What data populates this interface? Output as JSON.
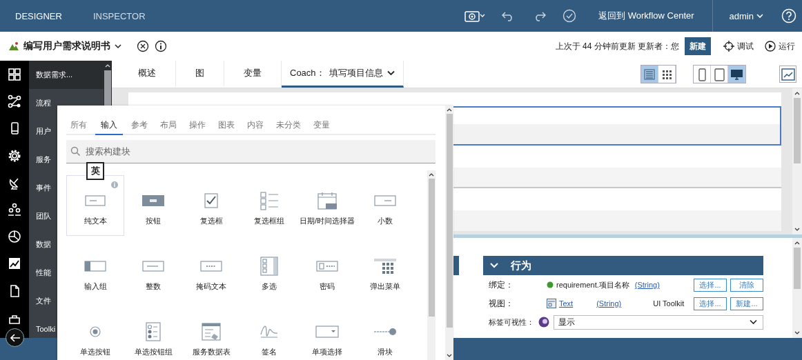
{
  "top_bar": {
    "tabs": [
      {
        "label": "DESIGNER",
        "selected": true
      },
      {
        "label": "INSPECTOR",
        "selected": false
      }
    ],
    "return_link": "返回到 Workflow Center",
    "user": "admin"
  },
  "title_bar": {
    "title": "编写用户需求说明书",
    "status": "上次于 44 分钟前更新 更新者：您",
    "new_button": "新建",
    "debug": "调试",
    "run": "运行"
  },
  "nav": {
    "items": [
      {
        "label": "数据需求...",
        "selected": true
      },
      {
        "label": "流程",
        "selected": false
      },
      {
        "label": "用户",
        "selected": false
      },
      {
        "label": "服务",
        "selected": false
      },
      {
        "label": "事件",
        "selected": false
      },
      {
        "label": "团队",
        "selected": false
      },
      {
        "label": "数据",
        "selected": false
      },
      {
        "label": "性能",
        "selected": false
      },
      {
        "label": "文件",
        "selected": false
      },
      {
        "label": "Toolki",
        "selected": false
      }
    ]
  },
  "editor_tabs": [
    {
      "kind": "plain",
      "label": "概述",
      "selected": false
    },
    {
      "kind": "plain",
      "label": "图",
      "selected": false
    },
    {
      "kind": "plain",
      "label": "变量",
      "selected": false
    },
    {
      "kind": "dropdown",
      "label": "Coach：",
      "value": "填写项目信息",
      "selected": true
    }
  ],
  "layout_toggles": [
    {
      "selected": true
    },
    {
      "selected": false
    }
  ],
  "device_toggles": [
    {
      "selected": false
    },
    {
      "selected": false
    },
    {
      "selected": true
    }
  ],
  "palette": {
    "tabs": [
      {
        "label": "所有",
        "selected": false
      },
      {
        "label": "输入",
        "selected": true
      },
      {
        "label": "参考",
        "selected": false
      },
      {
        "label": "布局",
        "selected": false
      },
      {
        "label": "操作",
        "selected": false
      },
      {
        "label": "图表",
        "selected": false
      },
      {
        "label": "内容",
        "selected": false
      },
      {
        "label": "未分类",
        "selected": false
      },
      {
        "label": "变量",
        "selected": false
      }
    ],
    "search": {
      "placeholder": "搜索构建块"
    },
    "ime_hint": "英",
    "items": [
      {
        "label": "纯文本",
        "selected": true
      },
      {
        "label": "按钮",
        "selected": false
      },
      {
        "label": "复选框",
        "selected": false
      },
      {
        "label": "复选框组",
        "selected": false
      },
      {
        "label": "日期/时间选择器",
        "selected": false
      },
      {
        "label": "小数",
        "selected": false
      },
      {
        "label": "输入组",
        "selected": false
      },
      {
        "label": "整数",
        "selected": false
      },
      {
        "label": "掩码文本",
        "selected": false
      },
      {
        "label": "多选",
        "selected": false
      },
      {
        "label": "密码",
        "selected": false
      },
      {
        "label": "弹出菜单",
        "selected": false
      },
      {
        "label": "单选按钮",
        "selected": false
      },
      {
        "label": "单选按钮组",
        "selected": false
      },
      {
        "label": "服务数据表",
        "selected": false
      },
      {
        "label": "签名",
        "selected": false
      },
      {
        "label": "单项选择",
        "selected": false
      },
      {
        "label": "滑块",
        "selected": false
      }
    ]
  },
  "properties": {
    "section": {
      "title": "行为",
      "expanded": true
    },
    "binding": {
      "label": "绑定：",
      "value": "requirement.项目名称",
      "type": "(String)",
      "buttons": [
        "选择...",
        "清除"
      ]
    },
    "view": {
      "label": "视图：",
      "value": "Text",
      "type": "(String)",
      "toolkit": "UI Toolkit",
      "buttons": [
        "选择...",
        "新建..."
      ]
    },
    "label_visibility": {
      "label": "标签可视性：",
      "value": "显示"
    }
  }
}
